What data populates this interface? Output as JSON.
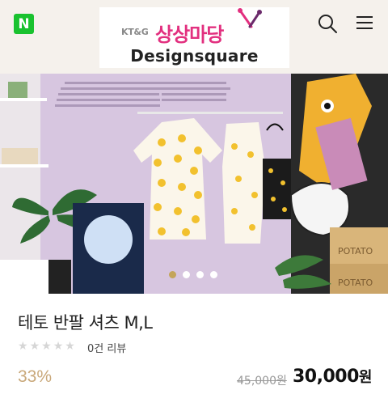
{
  "header": {
    "naver_label": "N",
    "logo": {
      "brand_prefix": "KT&G",
      "brand_korean": "상상마당",
      "brand_english": "Designsquare"
    }
  },
  "hero": {
    "slide_count": 4,
    "active_slide": 1
  },
  "product": {
    "title": "테토 반팔 셔츠 M,L",
    "rating_stars": 0,
    "rating_max": 5,
    "review_count": "0건 리뷰",
    "discount": "33%",
    "original_price": "45,000원",
    "price_amount": "30,000",
    "price_unit": "원"
  },
  "colors": {
    "naver_green": "#19c22f",
    "logo_pink": "#e2307f",
    "discount_gold": "#c9a87a",
    "active_dot": "#c4a55a"
  },
  "icons": {
    "search": "search-icon",
    "menu": "hamburger-menu-icon",
    "star": "star-icon"
  }
}
